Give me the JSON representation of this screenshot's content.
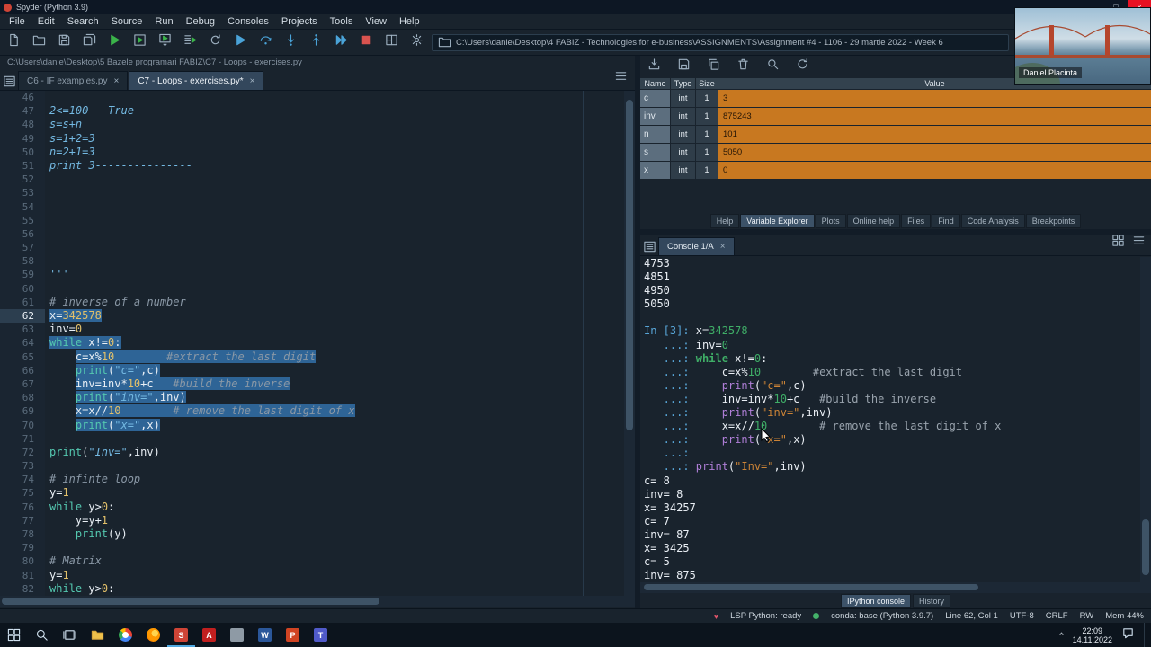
{
  "window": {
    "title": "Spyder (Python 3.9)"
  },
  "menus": [
    "File",
    "Edit",
    "Search",
    "Source",
    "Run",
    "Debug",
    "Consoles",
    "Projects",
    "Tools",
    "View",
    "Help"
  ],
  "toolbar": {
    "path": "C:\\Users\\danie\\Desktop\\4 FABIZ - Technologies for e-business\\ASSIGNMENTS\\Assignment #4 - 1106 - 29 martie 2022 - Week 6",
    "icons": [
      "new-file",
      "open-file",
      "save-file",
      "save-all",
      "run-file",
      "run-cell",
      "run-cell-advance",
      "run-selection",
      "rerun-cell",
      "debug-file",
      "step-over",
      "step-into",
      "step-return",
      "continue-execution",
      "stop-execution",
      "maximize-pane",
      "preferences"
    ]
  },
  "webcam": {
    "name": "Daniel Placinta"
  },
  "editor": {
    "breadcrumb": "C:\\Users\\danie\\Desktop\\5 Bazele programari FABIZ\\C7 - Loops - exercises.py",
    "tabs": [
      {
        "label": "C6 - IF examples.py",
        "active": false
      },
      {
        "label": "C7 - Loops - exercises.py*",
        "active": true
      }
    ],
    "lines": [
      {
        "n": 46,
        "segs": []
      },
      {
        "n": 47,
        "segs": [
          [
            "s",
            "2<=100 - True"
          ]
        ]
      },
      {
        "n": 48,
        "segs": [
          [
            "s",
            "s=s+n"
          ]
        ]
      },
      {
        "n": 49,
        "segs": [
          [
            "s",
            "s=1+2=3"
          ]
        ]
      },
      {
        "n": 50,
        "segs": [
          [
            "s",
            "n=2+1=3"
          ]
        ]
      },
      {
        "n": 51,
        "segs": [
          [
            "s",
            "print 3---------------"
          ]
        ]
      },
      {
        "n": 52,
        "segs": []
      },
      {
        "n": 53,
        "segs": []
      },
      {
        "n": 54,
        "segs": []
      },
      {
        "n": 55,
        "segs": []
      },
      {
        "n": 56,
        "segs": []
      },
      {
        "n": 57,
        "segs": []
      },
      {
        "n": 58,
        "segs": []
      },
      {
        "n": 59,
        "segs": [
          [
            "s",
            "'''"
          ]
        ]
      },
      {
        "n": 60,
        "segs": []
      },
      {
        "n": 61,
        "segs": [
          [
            "c",
            "# inverse of a number"
          ]
        ]
      },
      {
        "n": 62,
        "cur": true,
        "sel": true,
        "segs": [
          [
            "p",
            "x="
          ],
          [
            "n",
            "342578"
          ]
        ]
      },
      {
        "n": 63,
        "segs": [
          [
            "p",
            "inv="
          ],
          [
            "n",
            "0"
          ]
        ]
      },
      {
        "n": 64,
        "sel": true,
        "segs": [
          [
            "k",
            "while"
          ],
          [
            "p",
            " x!="
          ],
          [
            "n",
            "0"
          ],
          [
            "p",
            ":"
          ]
        ]
      },
      {
        "n": 65,
        "sel": true,
        "segs": [
          [
            "p",
            "    "
          ],
          [
            "p",
            "c=x%"
          ],
          [
            "n",
            "10"
          ],
          [
            "p",
            "        "
          ],
          [
            "c",
            "#extract the last digit"
          ]
        ]
      },
      {
        "n": 66,
        "sel": true,
        "segs": [
          [
            "p",
            "    "
          ],
          [
            "b",
            "print"
          ],
          [
            "p",
            "("
          ],
          [
            "s",
            "\"c=\""
          ],
          [
            "p",
            ",c)"
          ]
        ]
      },
      {
        "n": 67,
        "sel": true,
        "segs": [
          [
            "p",
            "    "
          ],
          [
            "p",
            "inv=inv*"
          ],
          [
            "n",
            "10"
          ],
          [
            "p",
            "+c   "
          ],
          [
            "c",
            "#build the inverse"
          ]
        ]
      },
      {
        "n": 68,
        "sel": true,
        "segs": [
          [
            "p",
            "    "
          ],
          [
            "b",
            "print"
          ],
          [
            "p",
            "("
          ],
          [
            "s",
            "\"inv=\""
          ],
          [
            "p",
            ",inv)"
          ]
        ]
      },
      {
        "n": 69,
        "sel": true,
        "segs": [
          [
            "p",
            "    "
          ],
          [
            "p",
            "x=x//"
          ],
          [
            "n",
            "10"
          ],
          [
            "p",
            "        "
          ],
          [
            "c",
            "# remove the last digit of x"
          ]
        ]
      },
      {
        "n": 70,
        "sel": true,
        "segs": [
          [
            "p",
            "    "
          ],
          [
            "b",
            "print"
          ],
          [
            "p",
            "("
          ],
          [
            "s",
            "\"x=\""
          ],
          [
            "p",
            ",x)"
          ]
        ]
      },
      {
        "n": 71,
        "segs": []
      },
      {
        "n": 72,
        "segs": [
          [
            "b",
            "print"
          ],
          [
            "p",
            "("
          ],
          [
            "s",
            "\"Inv=\""
          ],
          [
            "p",
            ",inv)"
          ]
        ]
      },
      {
        "n": 73,
        "segs": []
      },
      {
        "n": 74,
        "segs": [
          [
            "c",
            "# infinte loop"
          ]
        ]
      },
      {
        "n": 75,
        "segs": [
          [
            "p",
            "y="
          ],
          [
            "n",
            "1"
          ]
        ]
      },
      {
        "n": 76,
        "segs": [
          [
            "k",
            "while"
          ],
          [
            "p",
            " y>"
          ],
          [
            "n",
            "0"
          ],
          [
            "p",
            ":"
          ]
        ]
      },
      {
        "n": 77,
        "segs": [
          [
            "p",
            "    y=y+"
          ],
          [
            "n",
            "1"
          ]
        ]
      },
      {
        "n": 78,
        "segs": [
          [
            "p",
            "    "
          ],
          [
            "b",
            "print"
          ],
          [
            "p",
            "(y)"
          ]
        ]
      },
      {
        "n": 79,
        "segs": []
      },
      {
        "n": 80,
        "segs": [
          [
            "c",
            "# Matrix"
          ]
        ]
      },
      {
        "n": 81,
        "segs": [
          [
            "p",
            "y="
          ],
          [
            "n",
            "1"
          ]
        ]
      },
      {
        "n": 82,
        "segs": [
          [
            "k",
            "while"
          ],
          [
            "p",
            " y>"
          ],
          [
            "n",
            "0"
          ],
          [
            "p",
            ":"
          ]
        ]
      }
    ]
  },
  "variable_explorer": {
    "toolbar_icons": [
      "import-data",
      "save-data",
      "copy-data",
      "remove-variable",
      "search-variables",
      "refresh-variables"
    ],
    "columns": [
      "Name",
      "Type",
      "Size",
      "Value"
    ],
    "rows": [
      {
        "name": "c",
        "type": "int",
        "size": "1",
        "value": "3"
      },
      {
        "name": "inv",
        "type": "int",
        "size": "1",
        "value": "875243"
      },
      {
        "name": "n",
        "type": "int",
        "size": "1",
        "value": "101"
      },
      {
        "name": "s",
        "type": "int",
        "size": "1",
        "value": "5050"
      },
      {
        "name": "x",
        "type": "int",
        "size": "1",
        "value": "0"
      }
    ],
    "tabs": [
      "Help",
      "Variable Explorer",
      "Plots",
      "Online help",
      "Files",
      "Find",
      "Code Analysis",
      "Breakpoints"
    ],
    "active_tab": 1
  },
  "console": {
    "tab": "Console 1/A",
    "bottom_tabs": [
      "IPython console",
      "History"
    ],
    "active_bottom_tab": 0,
    "lines": [
      {
        "segs": [
          [
            "o",
            "4753"
          ]
        ]
      },
      {
        "segs": [
          [
            "o",
            "4851"
          ]
        ]
      },
      {
        "segs": [
          [
            "o",
            "4950"
          ]
        ]
      },
      {
        "segs": [
          [
            "o",
            "5050"
          ]
        ]
      },
      {
        "segs": []
      },
      {
        "segs": [
          [
            "pr",
            "In [3]: "
          ],
          [
            "p",
            "x="
          ],
          [
            "n",
            "342578"
          ]
        ]
      },
      {
        "segs": [
          [
            "pr",
            "   ...: "
          ],
          [
            "p",
            "inv="
          ],
          [
            "n",
            "0"
          ]
        ]
      },
      {
        "segs": [
          [
            "pr",
            "   ...: "
          ],
          [
            "k",
            "while"
          ],
          [
            "p",
            " x!="
          ],
          [
            "n",
            "0"
          ],
          [
            "p",
            ":"
          ]
        ]
      },
      {
        "segs": [
          [
            "pr",
            "   ...: "
          ],
          [
            "p",
            "    c=x%"
          ],
          [
            "n",
            "10"
          ],
          [
            "p",
            "        "
          ],
          [
            "c",
            "#extract the last digit"
          ]
        ]
      },
      {
        "segs": [
          [
            "pr",
            "   ...: "
          ],
          [
            "p",
            "    "
          ],
          [
            "f",
            "print"
          ],
          [
            "p",
            "("
          ],
          [
            "s",
            "\"c=\""
          ],
          [
            "p",
            ",c)"
          ]
        ]
      },
      {
        "segs": [
          [
            "pr",
            "   ...: "
          ],
          [
            "p",
            "    inv=inv*"
          ],
          [
            "n",
            "10"
          ],
          [
            "p",
            "+c   "
          ],
          [
            "c",
            "#build the inverse"
          ]
        ]
      },
      {
        "segs": [
          [
            "pr",
            "   ...: "
          ],
          [
            "p",
            "    "
          ],
          [
            "f",
            "print"
          ],
          [
            "p",
            "("
          ],
          [
            "s",
            "\"inv=\""
          ],
          [
            "p",
            ",inv)"
          ]
        ]
      },
      {
        "segs": [
          [
            "pr",
            "   ...: "
          ],
          [
            "p",
            "    x=x//"
          ],
          [
            "n",
            "10"
          ],
          [
            "p",
            "        "
          ],
          [
            "c",
            "# remove the last digit of x"
          ]
        ]
      },
      {
        "segs": [
          [
            "pr",
            "   ...: "
          ],
          [
            "p",
            "    "
          ],
          [
            "f",
            "print"
          ],
          [
            "p",
            "("
          ],
          [
            "s",
            "\"x=\""
          ],
          [
            "p",
            ",x)"
          ]
        ]
      },
      {
        "segs": [
          [
            "pr",
            "   ...: "
          ]
        ]
      },
      {
        "segs": [
          [
            "pr",
            "   ...: "
          ],
          [
            "f",
            "print"
          ],
          [
            "p",
            "("
          ],
          [
            "s",
            "\"Inv=\""
          ],
          [
            "p",
            ",inv)"
          ]
        ]
      },
      {
        "segs": [
          [
            "o",
            "c= 8"
          ]
        ]
      },
      {
        "segs": [
          [
            "o",
            "inv= 8"
          ]
        ]
      },
      {
        "segs": [
          [
            "o",
            "x= 34257"
          ]
        ]
      },
      {
        "segs": [
          [
            "o",
            "c= 7"
          ]
        ]
      },
      {
        "segs": [
          [
            "o",
            "inv= 87"
          ]
        ]
      },
      {
        "segs": [
          [
            "o",
            "x= 3425"
          ]
        ]
      },
      {
        "segs": [
          [
            "o",
            "c= 5"
          ]
        ]
      },
      {
        "segs": [
          [
            "o",
            "inv= 875"
          ]
        ]
      }
    ],
    "action_icons": [
      "console-environments",
      "console-options"
    ]
  },
  "statusbar": {
    "lsp": "LSP Python: ready",
    "env": "conda: base (Python 3.9.7)",
    "cursor": "Line 62, Col 1",
    "encoding": "UTF-8",
    "eol": "CRLF",
    "rw": "RW",
    "mem": "Mem 44%"
  },
  "taskbar": {
    "time": "22:09",
    "date": "14.11.2022",
    "items": [
      {
        "name": "start",
        "kind": "win"
      },
      {
        "name": "search",
        "kind": "search"
      },
      {
        "name": "task-view",
        "kind": "task"
      },
      {
        "name": "file-explorer",
        "kind": "folder"
      },
      {
        "name": "chrome",
        "kind": "chrome"
      },
      {
        "name": "firefox",
        "kind": "firefox"
      },
      {
        "name": "spyder",
        "kind": "letter",
        "label": "S",
        "color": "#cf4436",
        "active": true
      },
      {
        "name": "acrobat",
        "kind": "letter",
        "label": "A",
        "color": "#c11f1f"
      },
      {
        "name": "gray-app",
        "kind": "letter",
        "label": "",
        "color": "#8e9aa5"
      },
      {
        "name": "word",
        "kind": "letter",
        "label": "W",
        "color": "#2b579a"
      },
      {
        "name": "powerpoint",
        "kind": "letter",
        "label": "P",
        "color": "#d04423"
      },
      {
        "name": "teams",
        "kind": "letter",
        "label": "T",
        "color": "#505ac9"
      }
    ]
  },
  "colors": {
    "selection": "#2e6496",
    "variable_value_bg": "#c87820",
    "active_tab_bg": "#33475c",
    "keyword_teal": "#54c8b0",
    "string_blue": "#74b9e2",
    "number_yellow": "#e2c06a",
    "comment_gray": "#8a98a6",
    "prompt_blue": "#58a6d8",
    "console_green": "#3fae67",
    "console_orange": "#cb8336",
    "console_purple": "#b07fd8"
  }
}
